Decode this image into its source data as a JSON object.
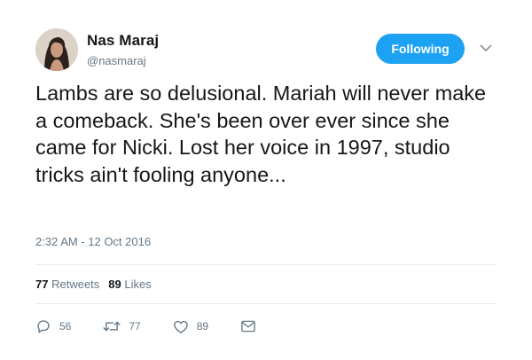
{
  "tweet": {
    "author": {
      "display_name": "Nas Maraj",
      "handle": "@nasmaraj"
    },
    "follow_button_label": "Following",
    "text": "Lambs are so delusional. Mariah will never make a comeback. She's been over ever since she came for Nicki. Lost her voice in 1997, studio tricks ain't fooling anyone...",
    "timestamp": "2:32 AM - 12 Oct 2016",
    "stats": {
      "retweets_count": "77",
      "retweets_label": "Retweets",
      "likes_count": "89",
      "likes_label": "Likes"
    },
    "actions": {
      "replies": "56",
      "retweets": "77",
      "likes": "89"
    },
    "colors": {
      "accent": "#1da1f2",
      "secondary_text": "#657786",
      "primary_text": "#14171a",
      "divider": "#e6ecf0"
    },
    "icons": [
      "reply-icon",
      "retweet-icon",
      "like-icon",
      "direct-message-icon",
      "chevron-down-icon"
    ]
  }
}
